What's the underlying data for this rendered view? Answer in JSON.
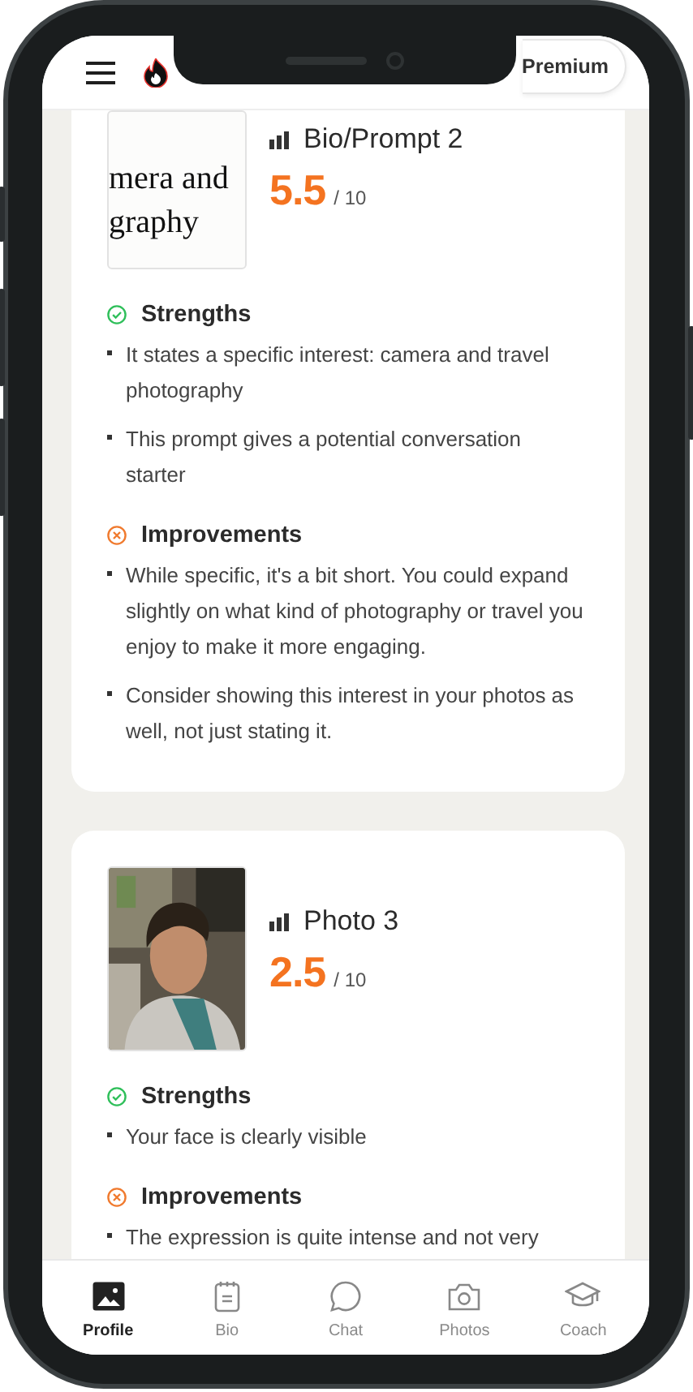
{
  "header": {
    "premium_label": "Premium"
  },
  "cards": [
    {
      "title": "Bio/Prompt 2",
      "score": "5.5",
      "out_of": "/ 10",
      "thumbnail": {
        "kind": "text",
        "lines": [
          "mera and",
          "graphy"
        ]
      },
      "sections": [
        {
          "kind": "strengths",
          "heading": "Strengths",
          "items": [
            "It states a specific interest: camera and travel photography",
            "This prompt gives a potential conversation starter"
          ]
        },
        {
          "kind": "improvements",
          "heading": "Improvements",
          "items": [
            "While specific, it's a bit short. You could expand slightly on what kind of photography or travel you enjoy to make it more engaging.",
            "Consider showing this interest in your photos as well, not just stating it."
          ]
        }
      ]
    },
    {
      "title": "Photo 3",
      "score": "2.5",
      "out_of": "/ 10",
      "sections": [
        {
          "kind": "strengths",
          "heading": "Strengths",
          "items": [
            "Your face is clearly visible"
          ]
        },
        {
          "kind": "improvements",
          "heading": "Improvements",
          "items": [
            "The expression is quite intense and not very"
          ]
        }
      ]
    }
  ],
  "nav": [
    {
      "label": "Profile",
      "selected": true
    },
    {
      "label": "Bio",
      "selected": false
    },
    {
      "label": "Chat",
      "selected": false
    },
    {
      "label": "Photos",
      "selected": false
    },
    {
      "label": "Coach",
      "selected": false
    }
  ]
}
